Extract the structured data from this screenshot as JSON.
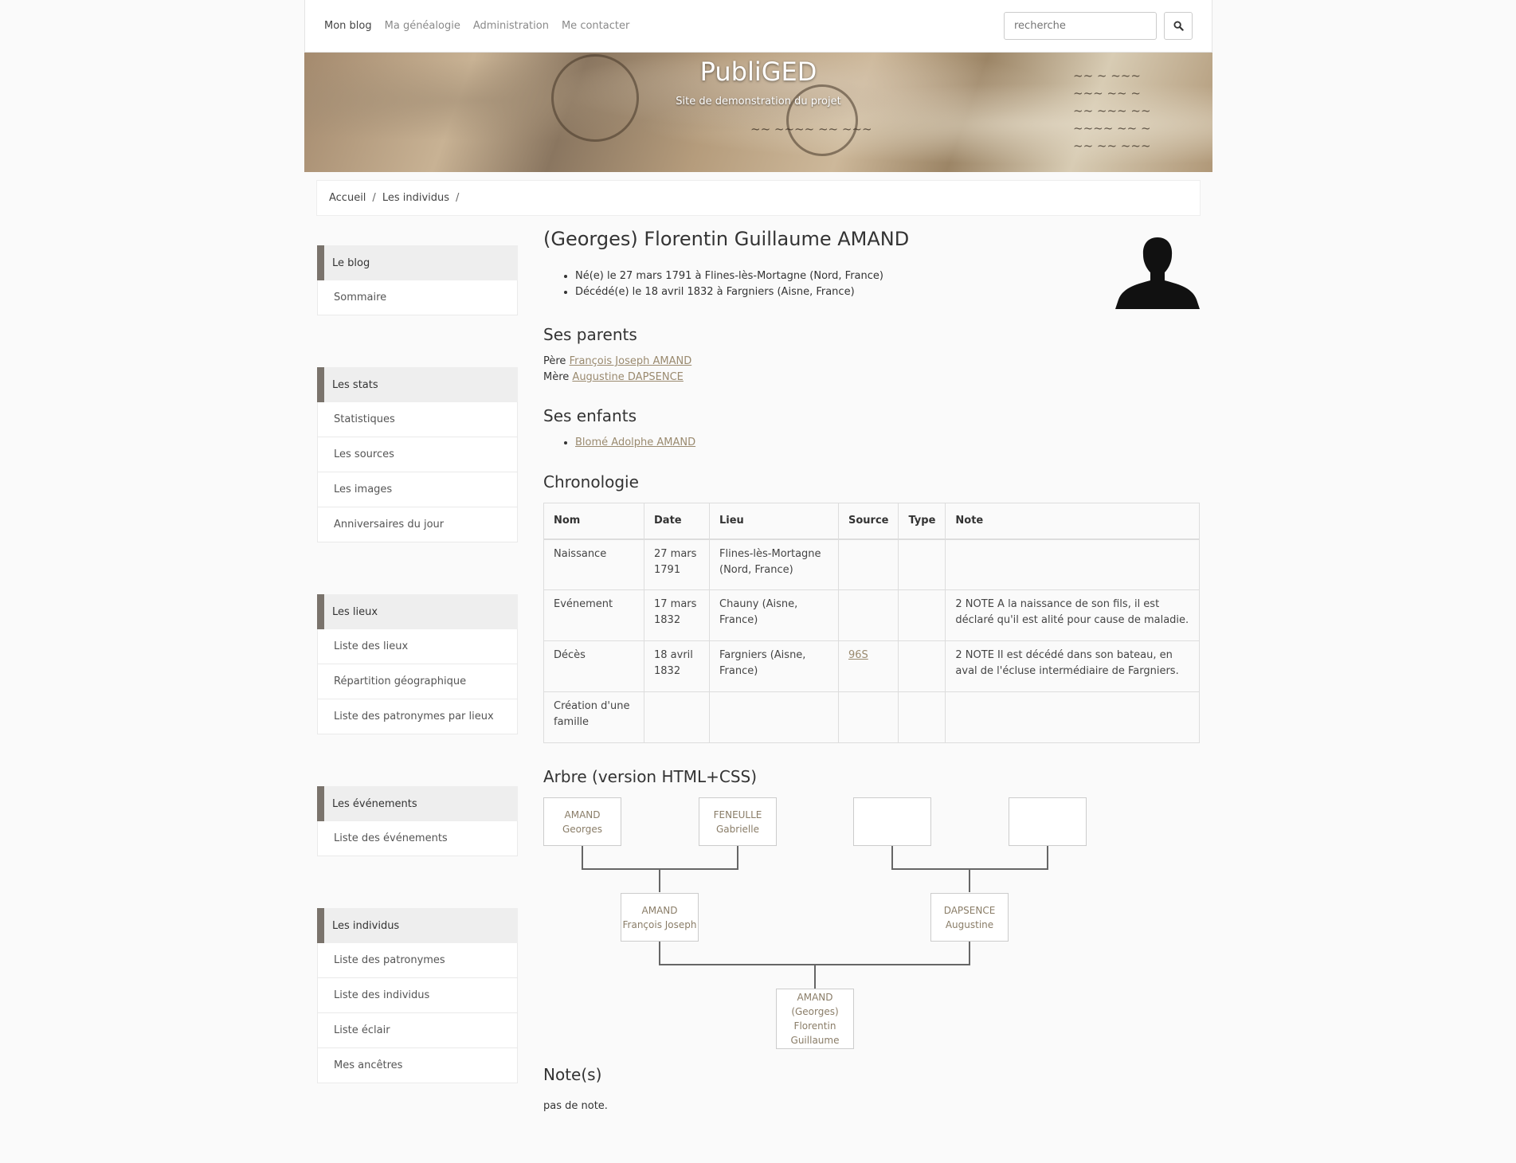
{
  "nav": {
    "items": [
      "Mon blog",
      "Ma généalogie",
      "Administration",
      "Me contacter"
    ],
    "search_placeholder": "recherche"
  },
  "banner": {
    "title": "PubliGED",
    "subtitle": "Site de demonstration du projet"
  },
  "breadcrumb": [
    "Accueil",
    "Les individus"
  ],
  "sidebar": [
    {
      "title": "Le blog",
      "items": [
        "Sommaire"
      ]
    },
    {
      "title": "Les stats",
      "items": [
        "Statistiques",
        "Les sources",
        "Les images",
        "Anniversaires du jour"
      ]
    },
    {
      "title": "Les lieux",
      "items": [
        "Liste des lieux",
        "Répartition géographique",
        "Liste des patronymes par lieux"
      ]
    },
    {
      "title": "Les événements",
      "items": [
        "Liste des événements"
      ]
    },
    {
      "title": "Les individus",
      "items": [
        "Liste des patronymes",
        "Liste des individus",
        "Liste éclair",
        "Mes ancêtres"
      ]
    }
  ],
  "person": {
    "name": "(Georges) Florentin Guillaume AMAND",
    "birth": "Né(e) le 27 mars 1791 à Flines-lès-Mortagne (Nord, France)",
    "death": "Décédé(e) le 18 avril 1832 à Fargniers (Aisne, France)"
  },
  "parents": {
    "heading": "Ses parents",
    "father_label": "Père",
    "father": "François Joseph AMAND",
    "mother_label": "Mère",
    "mother": "Augustine DAPSENCE"
  },
  "children": {
    "heading": "Ses enfants",
    "items": [
      "Blomé Adolphe AMAND"
    ]
  },
  "chronology": {
    "heading": "Chronologie",
    "columns": [
      "Nom",
      "Date",
      "Lieu",
      "Source",
      "Type",
      "Note"
    ],
    "rows": [
      [
        "Naissance",
        "27 mars 1791",
        "Flines-lès-Mortagne (Nord, France)",
        "",
        "",
        ""
      ],
      [
        "Evénement",
        "17 mars 1832",
        "Chauny (Aisne, France)",
        "",
        "",
        "2 NOTE A la naissance de son fils, il est déclaré qu'il est alité pour cause de maladie."
      ],
      [
        "Décès",
        "18 avril 1832",
        "Fargniers (Aisne, France)",
        "96S",
        "",
        "2 NOTE Il est décédé dans son bateau, en aval de l'écluse intermédiaire de Fargniers."
      ],
      [
        "Création d'une famille",
        "",
        "",
        "",
        "",
        ""
      ]
    ]
  },
  "tree": {
    "heading": "Arbre (version HTML+CSS)",
    "grandparents": [
      {
        "surname": "AMAND",
        "given": "Georges"
      },
      {
        "surname": "FENEULLE",
        "given": "Gabrielle"
      },
      {
        "surname": "",
        "given": ""
      },
      {
        "surname": "",
        "given": ""
      }
    ],
    "parents": [
      {
        "surname": "AMAND",
        "given": "François Joseph"
      },
      {
        "surname": "DAPSENCE",
        "given": "Augustine"
      }
    ],
    "self": {
      "surname": "AMAND",
      "given": "(Georges) Florentin Guillaume"
    }
  },
  "notes": {
    "heading": "Note(s)",
    "text": "pas de note."
  }
}
